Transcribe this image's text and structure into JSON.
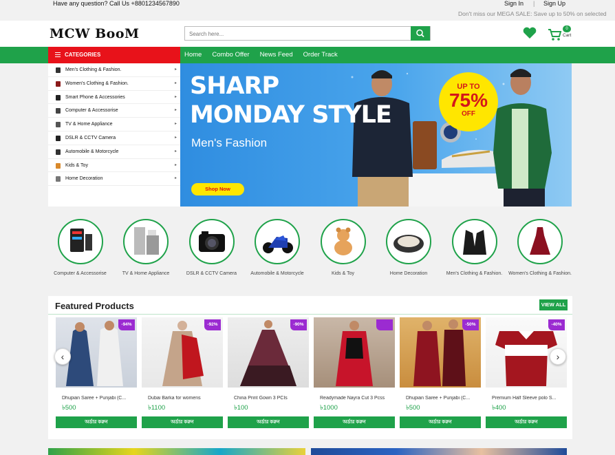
{
  "topbar": {
    "phone_text": "Have any question? Call Us +8801234567890",
    "signin": "Sign In",
    "separator": "|",
    "signup": "Sign Up",
    "marquee": "Don't miss our MEGA SALE: Save up to 50% on selected"
  },
  "header": {
    "logo": "MCW BooM",
    "search_placeholder": "Search here...",
    "cart_count": "0",
    "cart_label": "Cart"
  },
  "nav": {
    "categories_label": "CATEGORIES",
    "links": [
      "Home",
      "Combo Offer",
      "News Feed",
      "Order Track"
    ]
  },
  "categories": [
    {
      "label": "Men's Clothing & Fashion.",
      "icon": "shirt-icon",
      "color": "#333333"
    },
    {
      "label": "Women's Clothing & Fashion.",
      "icon": "dress-icon",
      "color": "#8b1a1a"
    },
    {
      "label": "Smart Phone & Accessories",
      "icon": "phone-icon",
      "color": "#222222"
    },
    {
      "label": "Computer & Accessorise",
      "icon": "computer-icon",
      "color": "#444444"
    },
    {
      "label": "TV & Home Appliance",
      "icon": "tv-icon",
      "color": "#555555"
    },
    {
      "label": "DSLR & CCTV Camera",
      "icon": "camera-icon",
      "color": "#222222"
    },
    {
      "label": "Automobile & Motorcycle",
      "icon": "motorcycle-icon",
      "color": "#333333"
    },
    {
      "label": "Kids & Toy",
      "icon": "toy-icon",
      "color": "#d9892b"
    },
    {
      "label": "Home Decoration",
      "icon": "home-decor-icon",
      "color": "#777777"
    }
  ],
  "banner": {
    "headline_1": "SHARP",
    "headline_2": "MONDAY STYLE",
    "subtitle": "Men's Fashion",
    "button": "Shop Now",
    "deal_up": "UP TO",
    "deal_percent": "75%",
    "deal_off": "OFF"
  },
  "circle_categories": [
    {
      "label": "Computer & Accessorise",
      "icon": "computer-icon"
    },
    {
      "label": "TV & Home Appliance",
      "icon": "appliance-icon"
    },
    {
      "label": "DSLR & CCTV Camera",
      "icon": "camera-icon"
    },
    {
      "label": "Automobile & Motorcycle",
      "icon": "motorcycle-icon"
    },
    {
      "label": "Kids & Toy",
      "icon": "teddy-bear-icon"
    },
    {
      "label": "Home Decoration",
      "icon": "pet-bed-icon"
    },
    {
      "label": "Men's Clothing & Fashion.",
      "icon": "blazer-icon"
    },
    {
      "label": "Women's Clothing & Fashion.",
      "icon": "dress-icon"
    }
  ],
  "featured": {
    "title": "Featured Products",
    "view_all": "VIEW ALL",
    "prev": "‹",
    "next": "›",
    "products": [
      {
        "name": "Dhupian Saree + Punjabi (C...",
        "price": "৳500",
        "discount": "-94%",
        "order": "অর্ডার করুন"
      },
      {
        "name": "Dubai Barka for womens",
        "price": "৳1100",
        "discount": "-92%",
        "order": "অর্ডার করুন"
      },
      {
        "name": "China Print Gown 3 PCIs",
        "price": "৳100",
        "discount": "-90%",
        "order": "অর্ডার করুন"
      },
      {
        "name": "Readymade Nayra Cut 3 Pcss",
        "price": "৳1000",
        "discount": "",
        "order": "অর্ডার করুন"
      },
      {
        "name": "Dhupian Saree + Punjabi (C...",
        "price": "৳500",
        "discount": "-50%",
        "order": "অর্ডার করুন"
      },
      {
        "name": "Premium Half Sleeve polo S...",
        "price": "৳400",
        "discount": "-40%",
        "order": "অর্ডার করুন"
      }
    ]
  },
  "colors": {
    "brand_green": "#1fa24a",
    "category_red": "#e8121a",
    "badge_purple": "#9b2bd1",
    "deal_yellow": "#ffe600"
  }
}
